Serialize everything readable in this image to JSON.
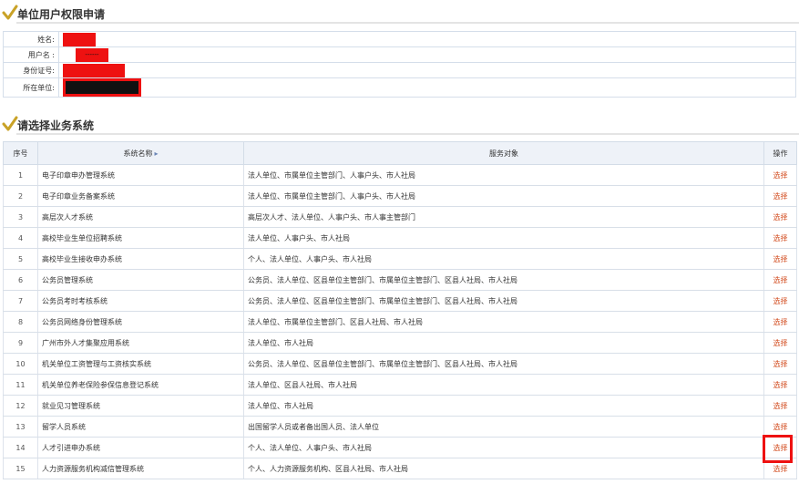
{
  "section1": {
    "title": "单位用户权限申请"
  },
  "info": {
    "rows": [
      {
        "label": "姓名:"
      },
      {
        "label": "用户名 :",
        "value": "------"
      },
      {
        "label": "身份证号:"
      },
      {
        "label": "所在单位:"
      }
    ]
  },
  "section2": {
    "title": "请选择业务系统"
  },
  "grid": {
    "headers": {
      "no": "序号",
      "name": "系统名称",
      "sort_arrow": "▸",
      "target": "服务对象",
      "op": "操作"
    },
    "rows": [
      {
        "no": "1",
        "name": "电子印章申办管理系统",
        "target": "法人单位、市属单位主管部门、人事户头、市人社局",
        "op": "选择"
      },
      {
        "no": "2",
        "name": "电子印章业务备案系统",
        "target": "法人单位、市属单位主管部门、人事户头、市人社局",
        "op": "选择"
      },
      {
        "no": "3",
        "name": "高层次人才系统",
        "target": "高层次人才、法人单位、人事户头、市人事主管部门",
        "op": "选择"
      },
      {
        "no": "4",
        "name": "高校毕业生单位招聘系统",
        "target": "法人单位、人事户头、市人社局",
        "op": "选择"
      },
      {
        "no": "5",
        "name": "高校毕业生接收申办系统",
        "target": "个人、法人单位、人事户头、市人社局",
        "op": "选择"
      },
      {
        "no": "6",
        "name": "公务员管理系统",
        "target": "公务员、法人单位、区县单位主管部门、市属单位主管部门、区县人社局、市人社局",
        "op": "选择"
      },
      {
        "no": "7",
        "name": "公务员考时考核系统",
        "target": "公务员、法人单位、区县单位主管部门、市属单位主管部门、区县人社局、市人社局",
        "op": "选择"
      },
      {
        "no": "8",
        "name": "公务员网络身份管理系统",
        "target": "法人单位、市属单位主管部门、区县人社局、市人社局",
        "op": "选择"
      },
      {
        "no": "9",
        "name": "广州市外人才集聚应用系统",
        "target": "法人单位、市人社局",
        "op": "选择"
      },
      {
        "no": "10",
        "name": "机关单位工资管理与工资核实系统",
        "target": "公务员、法人单位、区县单位主管部门、市属单位主管部门、区县人社局、市人社局",
        "op": "选择"
      },
      {
        "no": "11",
        "name": "机关单位养老保险参保信息登记系统",
        "target": "法人单位、区县人社局、市人社局",
        "op": "选择"
      },
      {
        "no": "12",
        "name": "就业见习管理系统",
        "target": "法人单位、市人社局",
        "op": "选择"
      },
      {
        "no": "13",
        "name": "留学人员系统",
        "target": "出国留学人员或者备出国人员、法人单位",
        "op": "选择"
      },
      {
        "no": "14",
        "name": "人才引进申办系统",
        "target": "个人、法人单位、人事户头、市人社局",
        "op": "选择"
      },
      {
        "no": "15",
        "name": "人力资源服务机构减信管理系统",
        "target": "个人、人力资源服务机构、区县人社局、市人社局",
        "op": "选择"
      }
    ]
  },
  "colors": {
    "accent_red": "#ee1111",
    "link_orange": "#d24a1c",
    "header_bg": "#eef2f8"
  }
}
